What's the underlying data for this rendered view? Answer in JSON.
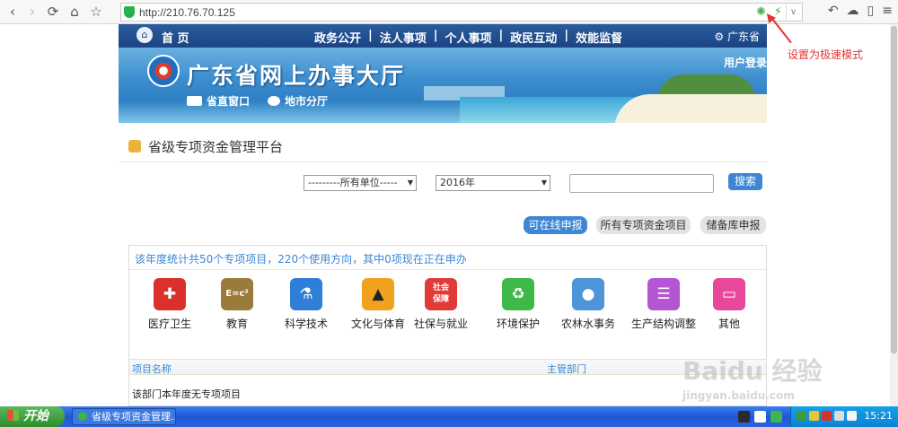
{
  "browser": {
    "url": "http://210.76.70.125",
    "annotation": "设置为极速模式"
  },
  "site": {
    "home_label": "首 页",
    "nav": [
      "政务公开",
      "法人事项",
      "个人事项",
      "政民互动",
      "效能监督"
    ],
    "nav_separator": "|",
    "region_label": "广东省",
    "title": "广东省网上办事大厅",
    "login_label": "用户登录",
    "sub_links": [
      "省直窗口",
      "地市分厅"
    ],
    "platform_title": "省级专项资金管理平台"
  },
  "filters": {
    "unit_select": "---------所有单位-----",
    "year_select": "2016年",
    "search_value": "",
    "search_button": "搜索"
  },
  "tabs": [
    {
      "label": "可在线申报",
      "active": true
    },
    {
      "label": "所有专项资金项目",
      "active": false
    },
    {
      "label": "储备库申报",
      "active": false
    }
  ],
  "summary": "该年度统计共50个专项项目，220个使用方向，其中0项现在正在申办",
  "categories": [
    {
      "label": "医疗卫生",
      "icon": "medical-kit-icon",
      "color": "#d9312e",
      "glyph": "✚"
    },
    {
      "label": "教育",
      "icon": "chalkboard-icon",
      "color": "#9b7b3a",
      "glyph": "E=c²"
    },
    {
      "label": "科学技术",
      "icon": "flask-icon",
      "color": "#2f7fd8",
      "glyph": "⚗"
    },
    {
      "label": "文化与体育",
      "icon": "graduation-cap-icon",
      "color": "#f0a21f",
      "glyph": "🎓"
    },
    {
      "label": "社保与就业",
      "icon": "social-security-icon",
      "color": "#e03b36",
      "glyph": "社会保障"
    },
    {
      "label": "环境保护",
      "icon": "recycle-icon",
      "color": "#3fb84a",
      "glyph": "♻"
    },
    {
      "label": "农林水事务",
      "icon": "water-hands-icon",
      "color": "#4b95d8",
      "glyph": "💧"
    },
    {
      "label": "生产结构调整",
      "icon": "layers-icon",
      "color": "#b455d4",
      "glyph": "≋"
    },
    {
      "label": "其他",
      "icon": "monitor-icon",
      "color": "#e8489a",
      "glyph": "▭"
    }
  ],
  "table": {
    "columns": [
      "项目名称",
      "主管部门"
    ],
    "empty_message": "该部门本年度无专项项目"
  },
  "taskbar": {
    "start_label": "开始",
    "task_label": "省级专项资金管理...",
    "clock": "15:21"
  },
  "watermark": {
    "main": "Baidu 经验",
    "sub": "jingyan.baidu.com"
  }
}
